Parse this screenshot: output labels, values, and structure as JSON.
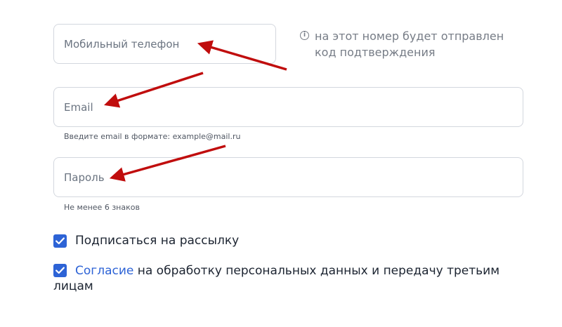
{
  "phone": {
    "placeholder": "Мобильный телефон",
    "note_line1": "на этот номер будет отправлен",
    "note_line2": "код подтверждения",
    "note_icon": "info-icon"
  },
  "email": {
    "placeholder": "Email",
    "hint": "Введите email в формате: example@mail.ru"
  },
  "password": {
    "placeholder": "Пароль",
    "hint": "Не менее 6 знаков"
  },
  "subscribe": {
    "label": "Подписаться на рассылку",
    "checked": true
  },
  "consent": {
    "link_text": "Согласие",
    "text_line1": " на обработку персональных данных и передачу третьим",
    "text_line2": "лицам",
    "checked": true
  },
  "colors": {
    "accent": "#2d63d6",
    "annotation_arrow": "#c00d0d"
  }
}
